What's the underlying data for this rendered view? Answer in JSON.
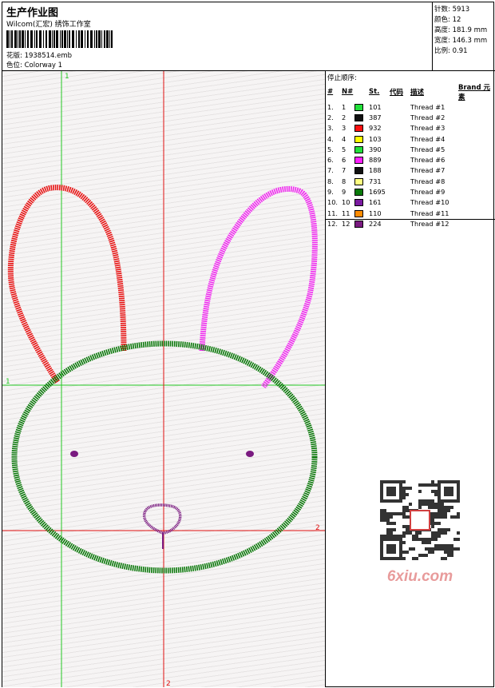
{
  "header": {
    "title": "生产作业图",
    "software": "Wilcom(汇宏) 绣饰工作室",
    "design_file": "花版:  1938514.emb",
    "colorway": "色位:  Colorway 1"
  },
  "stats": [
    {
      "label": "针数:",
      "value": "5913"
    },
    {
      "label": "颜色:",
      "value": "12"
    },
    {
      "label": "高度:",
      "value": "181.9 mm"
    },
    {
      "label": "宽度:",
      "value": "146.3 mm"
    },
    {
      "label": "比例:",
      "value": "0.91"
    }
  ],
  "thread_table": {
    "stop_sequence_label": "停止顺序:",
    "headers": [
      "#",
      "N#",
      "St.",
      "代码",
      "描述",
      "Brand",
      "元素"
    ],
    "rows": [
      {
        "idx": "1.",
        "no": "1",
        "color": "#22e03a",
        "stitches": "101",
        "desc": "Thread #1"
      },
      {
        "idx": "2.",
        "no": "2",
        "color": "#111111",
        "stitches": "387",
        "desc": "Thread #2"
      },
      {
        "idx": "3.",
        "no": "3",
        "color": "#ff1010",
        "stitches": "932",
        "desc": "Thread #3"
      },
      {
        "idx": "4.",
        "no": "4",
        "color": "#ffff00",
        "stitches": "103",
        "desc": "Thread #4"
      },
      {
        "idx": "5.",
        "no": "5",
        "color": "#22e03a",
        "stitches": "390",
        "desc": "Thread #5"
      },
      {
        "idx": "6.",
        "no": "6",
        "color": "#ff20ff",
        "stitches": "889",
        "desc": "Thread #6"
      },
      {
        "idx": "7.",
        "no": "7",
        "color": "#111111",
        "stitches": "188",
        "desc": "Thread #7"
      },
      {
        "idx": "8.",
        "no": "8",
        "color": "#ffff80",
        "stitches": "731",
        "desc": "Thread #8"
      },
      {
        "idx": "9.",
        "no": "9",
        "color": "#0a7a0a",
        "stitches": "1695",
        "desc": "Thread #9"
      },
      {
        "idx": "10.",
        "no": "10",
        "color": "#7a1aa0",
        "stitches": "161",
        "desc": "Thread #10"
      },
      {
        "idx": "11.",
        "no": "11",
        "color": "#ff8c00",
        "stitches": "110",
        "desc": "Thread #11"
      },
      {
        "idx": "12.",
        "no": "12",
        "color": "#7a1a80",
        "stitches": "224",
        "desc": "Thread #12"
      }
    ]
  },
  "guides": {
    "v1_label": "1",
    "v2_label": "2",
    "h1_label": "1",
    "h2_label": "2"
  },
  "colors": {
    "left_ear": "#e81414",
    "right_ear": "#f02cf0",
    "face": "#0d7a0d",
    "features": "#7a1a80",
    "guide_green": "#22c822",
    "guide_red": "#e01010"
  },
  "watermark": {
    "text": "6xiu.com",
    "icon": "qr-code-icon"
  }
}
